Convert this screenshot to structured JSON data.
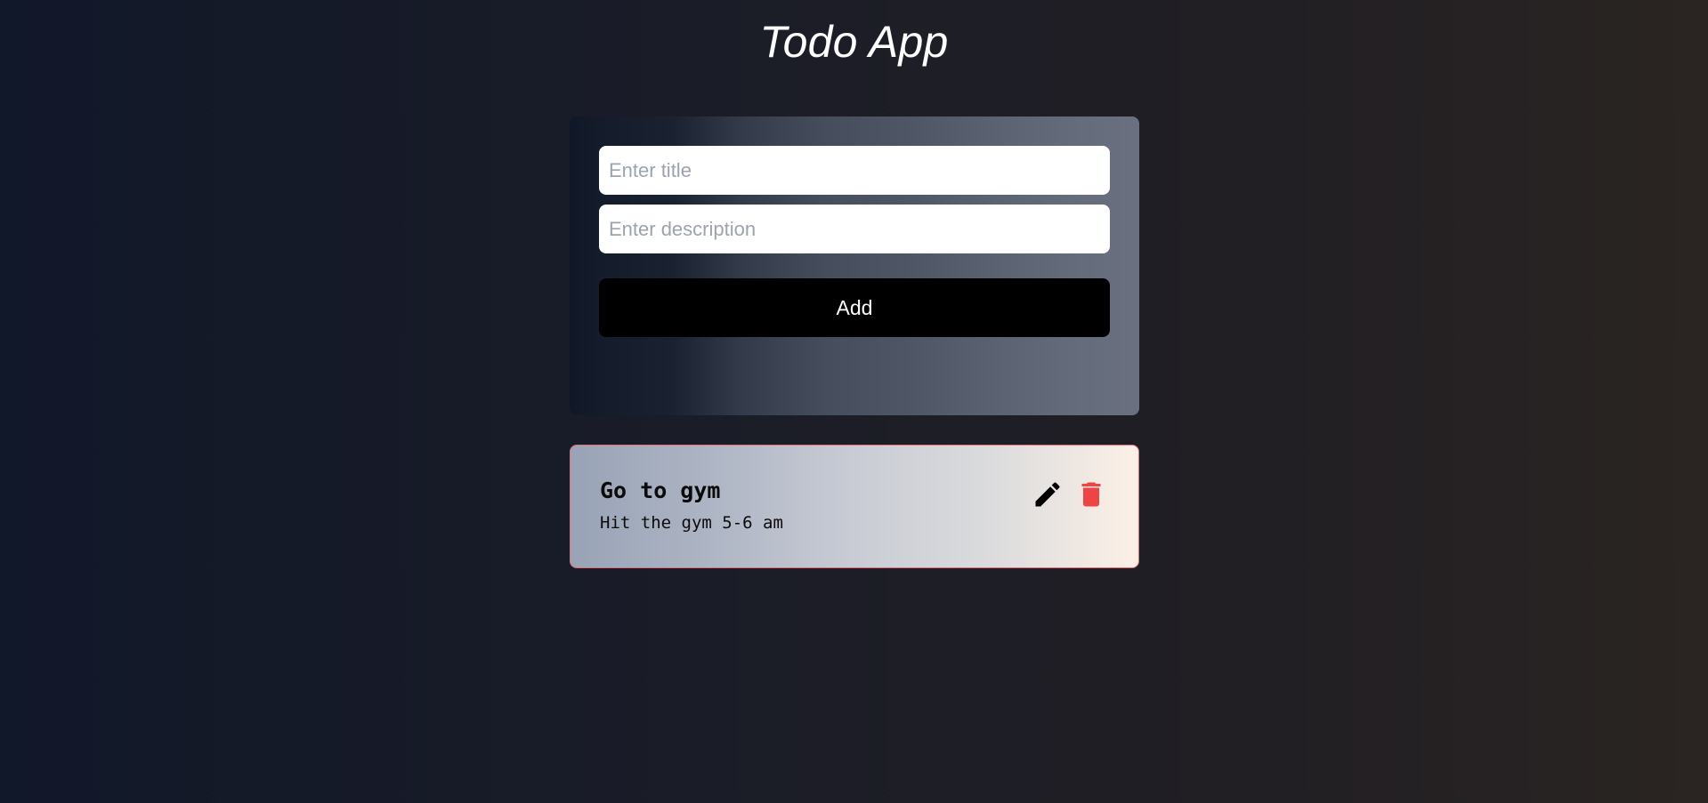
{
  "app": {
    "title": "Todo App"
  },
  "form": {
    "title_placeholder": "Enter title",
    "title_value": "",
    "description_placeholder": "Enter description",
    "description_value": "",
    "add_label": "Add"
  },
  "todos": [
    {
      "title": "Go to gym",
      "description": "Hit the gym 5-6 am",
      "edit_icon": "pencil-icon",
      "delete_icon": "trash-icon"
    }
  ],
  "colors": {
    "add_button_bg": "#000000",
    "delete_icon": "#ef4444",
    "edit_icon": "#000000",
    "todo_border": "#e8707a"
  }
}
